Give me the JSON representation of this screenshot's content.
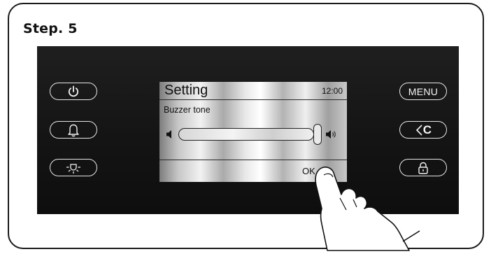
{
  "step_title": "Step. 5",
  "left_buttons": [
    {
      "icon": "power-icon"
    },
    {
      "icon": "bell-icon"
    },
    {
      "icon": "light-icon"
    }
  ],
  "right_buttons": [
    {
      "label": "MENU"
    },
    {
      "icon": "back-icon",
      "label": "C"
    },
    {
      "icon": "lock-icon"
    }
  ],
  "screen": {
    "title": "Setting",
    "time": "12:00",
    "subtitle": "Buzzer tone",
    "slider_level_fraction": 1.0,
    "slider_min_icon": "speaker-low-icon",
    "slider_max_icon": "speaker-high-icon",
    "ok_label": "OK"
  },
  "pointer_icon": "finger-pointer-icon"
}
